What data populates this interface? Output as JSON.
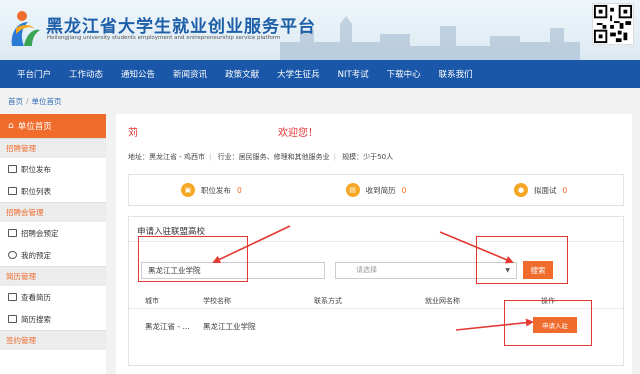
{
  "header": {
    "title": "黑龙江省大学生就业创业服务平台",
    "subtitle": "Heilongjiang university students employment and entrepreneurship service platform"
  },
  "nav": {
    "items": [
      "平台门户",
      "工作动态",
      "通知公告",
      "新闻资讯",
      "政策文献",
      "大学生征兵",
      "NIT考试",
      "下载中心",
      "联系我们"
    ]
  },
  "breadcrumb": {
    "home": "首页",
    "current": "单位首页"
  },
  "sidebar": {
    "head": "单位首页",
    "groups": [
      {
        "title": "招聘管理",
        "items": [
          "职位发布",
          "职位列表"
        ]
      },
      {
        "title": "招聘会管理",
        "items": [
          "招聘会预定",
          "我的预定"
        ]
      },
      {
        "title": "简历管理",
        "items": [
          "查看简历",
          "简历搜索"
        ]
      },
      {
        "title": "签约管理",
        "items": []
      }
    ]
  },
  "main": {
    "welcome_name": "苅",
    "welcome_text": "欢迎您！",
    "info": {
      "address": "地址：黑龙江省 - 鸡西市",
      "industry": "行业：居民服务、修理和其他服务业",
      "scale": "规模：少于50人"
    },
    "stats": [
      {
        "label": "职位发布",
        "count": "0",
        "icon": "briefcase-icon"
      },
      {
        "label": "收到简历",
        "count": "0",
        "icon": "resume-icon"
      },
      {
        "label": "拟面试",
        "count": "0",
        "icon": "interview-icon"
      }
    ],
    "panel": {
      "title": "申请入驻联盟高校",
      "school_input_value": "黑龙江工业学院",
      "region_placeholder": "请选择",
      "search_label": "搜索",
      "columns": [
        "城市",
        "学校名称",
        "联系方式",
        "就业网名称",
        "操作"
      ],
      "rows": [
        {
          "city": "黑龙江省 - ...",
          "school": "黑龙江工业学院",
          "contact": "",
          "site": "",
          "action": "申请入驻"
        }
      ]
    }
  },
  "colors": {
    "brand_blue": "#1a57a8",
    "accent_orange": "#ef6c2c",
    "annotation_red": "#e23a33"
  }
}
